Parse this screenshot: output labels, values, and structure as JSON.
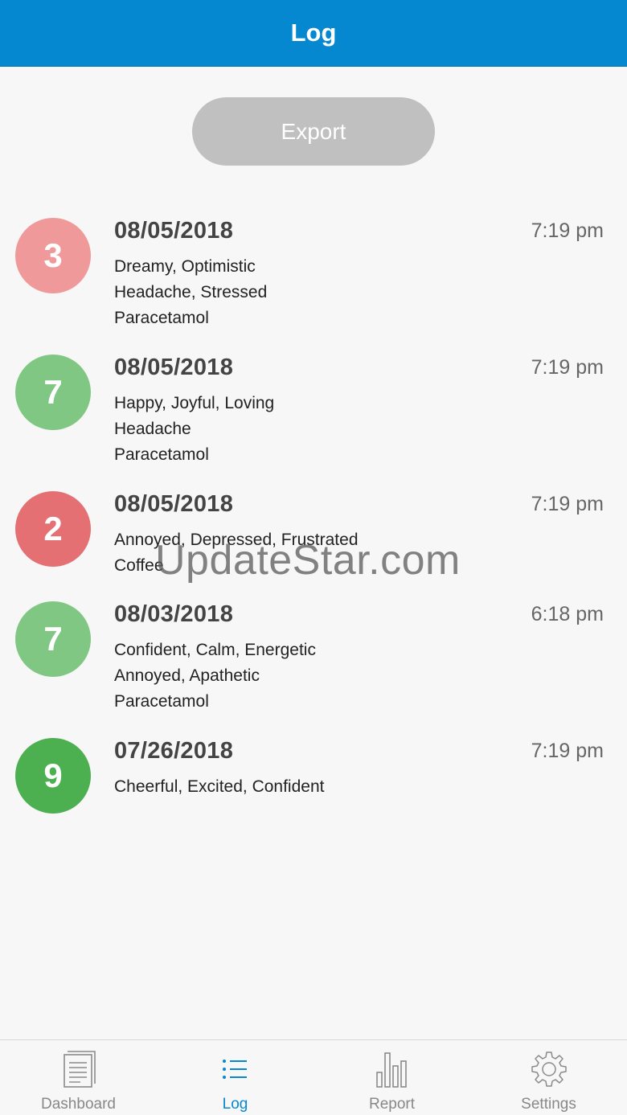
{
  "header": {
    "title": "Log"
  },
  "export_button": {
    "label": "Export"
  },
  "entries": [
    {
      "score": "3",
      "color": "#f0999b",
      "date": "08/05/2018",
      "time": "7:19 pm",
      "lines": [
        "Dreamy, Optimistic",
        "Headache, Stressed",
        "Paracetamol"
      ]
    },
    {
      "score": "7",
      "color": "#81c784",
      "date": "08/05/2018",
      "time": "7:19 pm",
      "lines": [
        "Happy, Joyful, Loving",
        "Headache",
        "Paracetamol"
      ]
    },
    {
      "score": "2",
      "color": "#e57073",
      "date": "08/05/2018",
      "time": "7:19 pm",
      "lines": [
        "Annoyed, Depressed, Frustrated",
        "Coffee"
      ]
    },
    {
      "score": "7",
      "color": "#81c784",
      "date": "08/03/2018",
      "time": "6:18 pm",
      "lines": [
        "Confident, Calm, Energetic",
        "Annoyed, Apathetic",
        "Paracetamol"
      ]
    },
    {
      "score": "9",
      "color": "#4caf50",
      "date": "07/26/2018",
      "time": "7:19 pm",
      "lines": [
        "Cheerful, Excited, Confident"
      ]
    }
  ],
  "watermark": "UpdateStar.com",
  "nav": {
    "active": "log",
    "items": [
      {
        "id": "dashboard",
        "label": "Dashboard",
        "icon": "document-icon"
      },
      {
        "id": "log",
        "label": "Log",
        "icon": "list-icon"
      },
      {
        "id": "report",
        "label": "Report",
        "icon": "bar-chart-icon"
      },
      {
        "id": "settings",
        "label": "Settings",
        "icon": "gear-icon"
      }
    ]
  },
  "colors": {
    "accent": "#0688d1",
    "export_bg": "#c0c0c0"
  }
}
